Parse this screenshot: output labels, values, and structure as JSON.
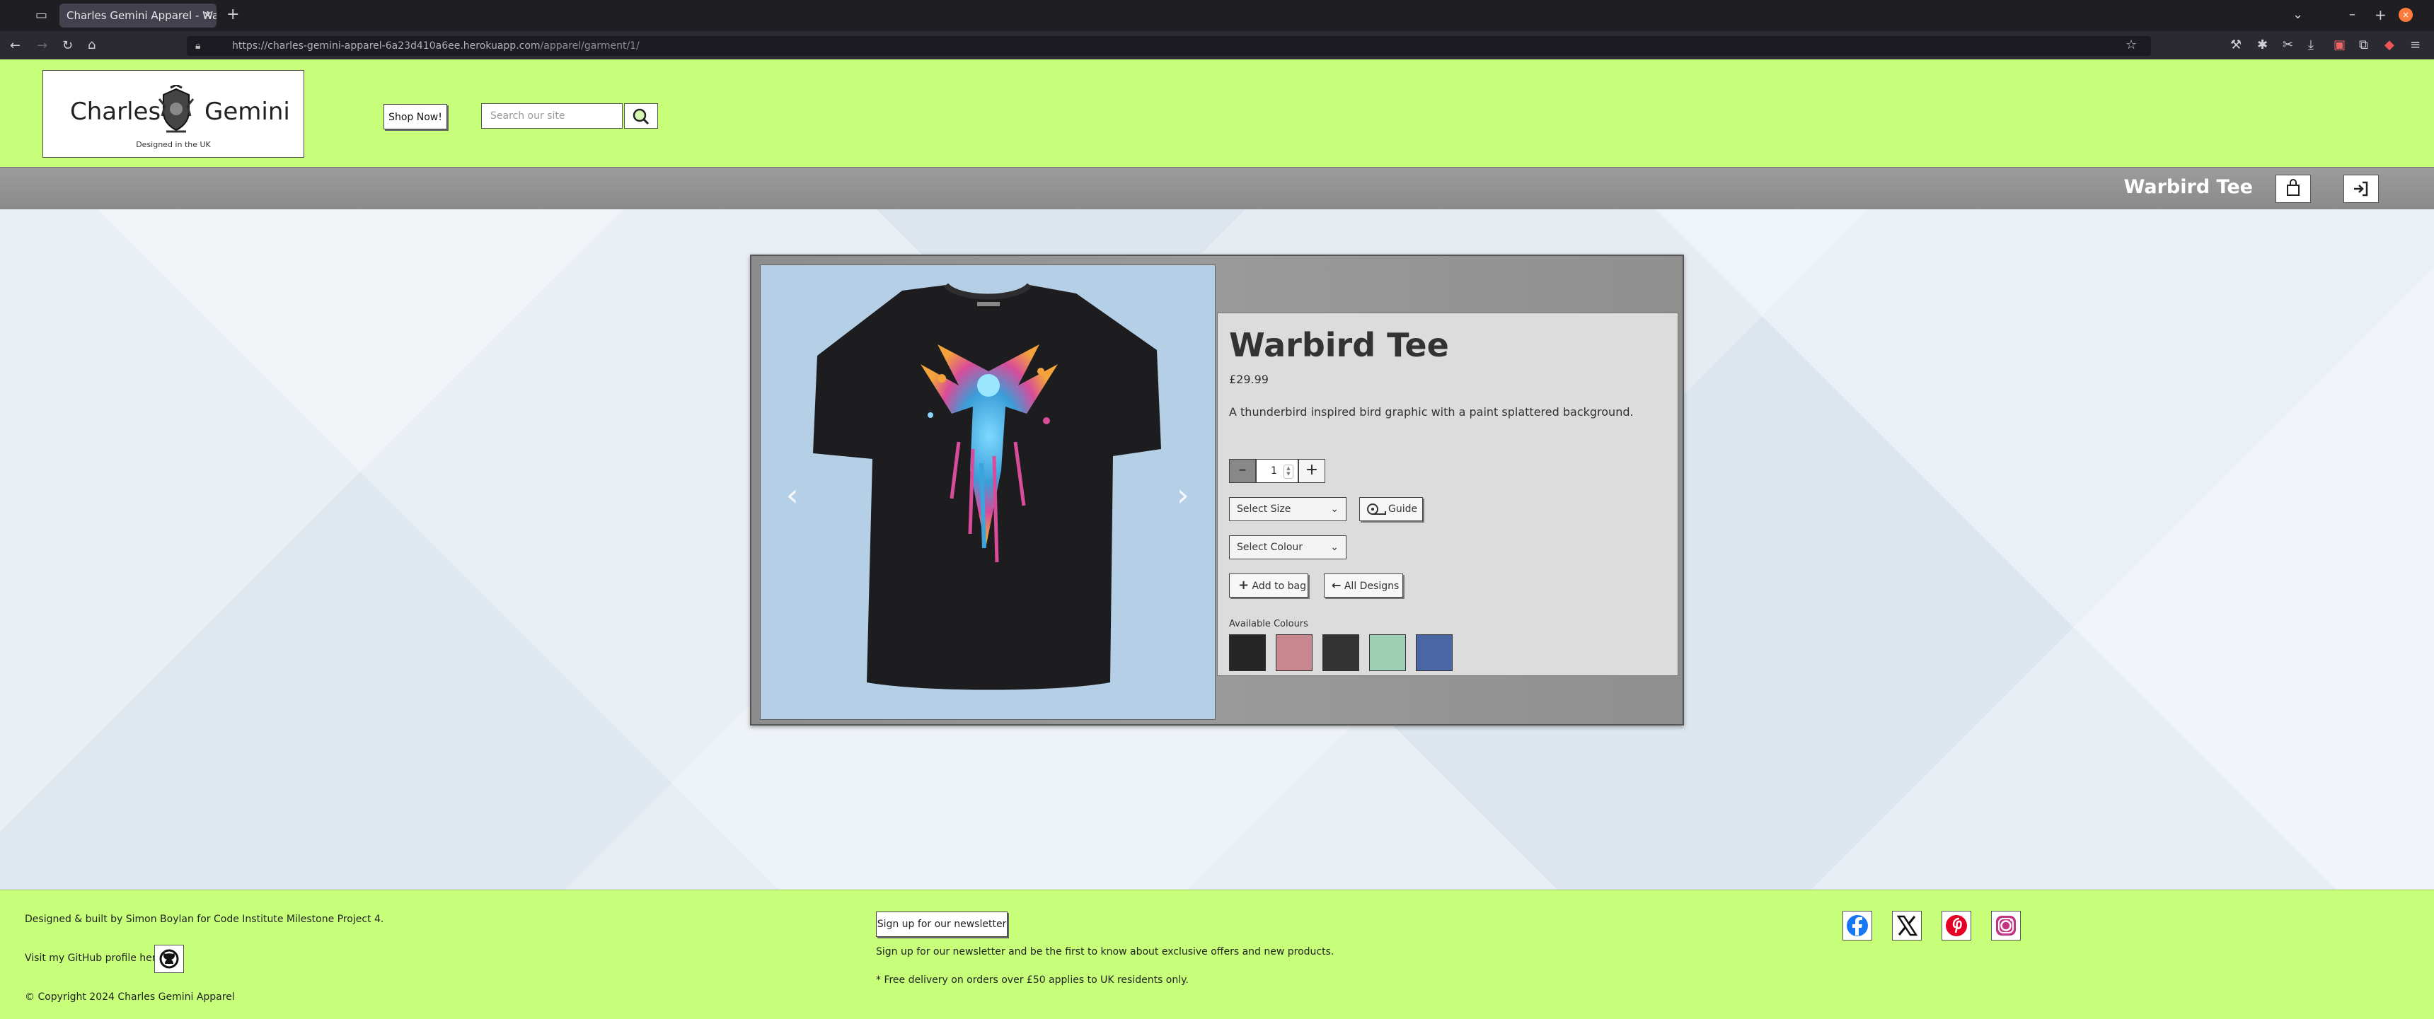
{
  "browser": {
    "tab_title": "Charles Gemini Apparel - Warb",
    "url_host": "https://charles-gemini-apparel-6a23d410a6ee.herokuapp.com",
    "url_path": "/apparel/garment/1/"
  },
  "header": {
    "logo_left": "Charles",
    "logo_right": "Gemini",
    "logo_tagline": "Designed in the UK",
    "shop_button": "Shop Now!",
    "search_placeholder": "Search our site"
  },
  "navbar": {
    "title": "Warbird Tee"
  },
  "product": {
    "name": "Warbird Tee",
    "price": "£29.99",
    "description": "A thunderbird inspired bird graphic with a paint splattered background.",
    "quantity": "1",
    "size_select": "Select Size",
    "guide_button": "Guide",
    "colour_select": "Select Colour",
    "add_to_bag": "Add to bag",
    "all_designs": "All Designs",
    "available_colours_label": "Available Colours",
    "swatches": [
      "#262626",
      "#c9878f",
      "#333333",
      "#9fcfb4",
      "#4a66a5"
    ]
  },
  "footer": {
    "credit": "Designed & built by Simon Boylan for Code Institute Milestone Project 4.",
    "github_text": "Visit my GitHub profile here:",
    "copyright": "© Copyright 2024 Charles Gemini Apparel",
    "newsletter_button": "Sign up for our newsletter",
    "newsletter_text": "Sign up for our newsletter and be the first to know about exclusive offers and new products.",
    "delivery_text": "* Free delivery on orders over £50 applies to UK residents only."
  },
  "colors": {
    "header_bg": "#c7ff7a",
    "navbar_bg": "#8a8a8a",
    "page_bg": "#e9eef4",
    "facebook": "#1877f2",
    "pinterest": "#e60023",
    "instagram": "#c13584"
  }
}
